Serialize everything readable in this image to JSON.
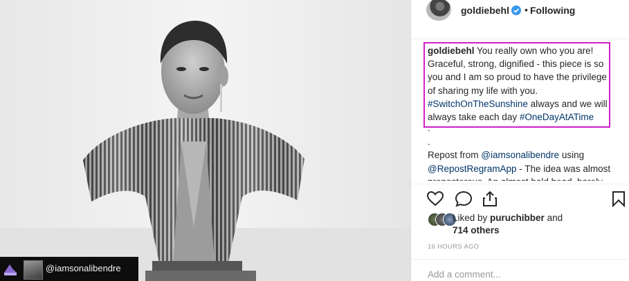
{
  "post": {
    "tag_username": "@iamsonalibendre"
  },
  "header": {
    "username": "goldiebehl",
    "separator": "•",
    "follow_status": "Following"
  },
  "caption": {
    "username": "goldiebehl",
    "text_part1": " You really own who you are! Graceful, strong, dignified - this piece is so you and I am so proud to have the privilege of sharing my life with you. ",
    "hashtag1": "#SwitchOnTheSunshine",
    "text_part2": " always and we will always take each day ",
    "hashtag2": "#OneDayAtATime"
  },
  "repost": {
    "dot1": ".",
    "dot2": ".",
    "text_part1": "Repost from ",
    "mention1": "@iamsonalibendre",
    "text_part2": " using ",
    "mention2": "@RepostRegramApp",
    "text_part3": " - The idea was almost preposterous. An almost bald head, barely"
  },
  "likes": {
    "prefix": "Liked by ",
    "user": "puruchibber",
    "and": " and",
    "others": "714 others"
  },
  "timestamp": "16 HOURS AGO",
  "comment": {
    "placeholder": "Add a comment..."
  },
  "icons": {
    "like": "heart-icon",
    "comment": "comment-icon",
    "share": "share-icon",
    "save": "bookmark-icon",
    "verified": "verified-badge-icon"
  },
  "colors": {
    "highlight": "#d01fc6",
    "link": "#003569",
    "verified": "#3897f0"
  }
}
